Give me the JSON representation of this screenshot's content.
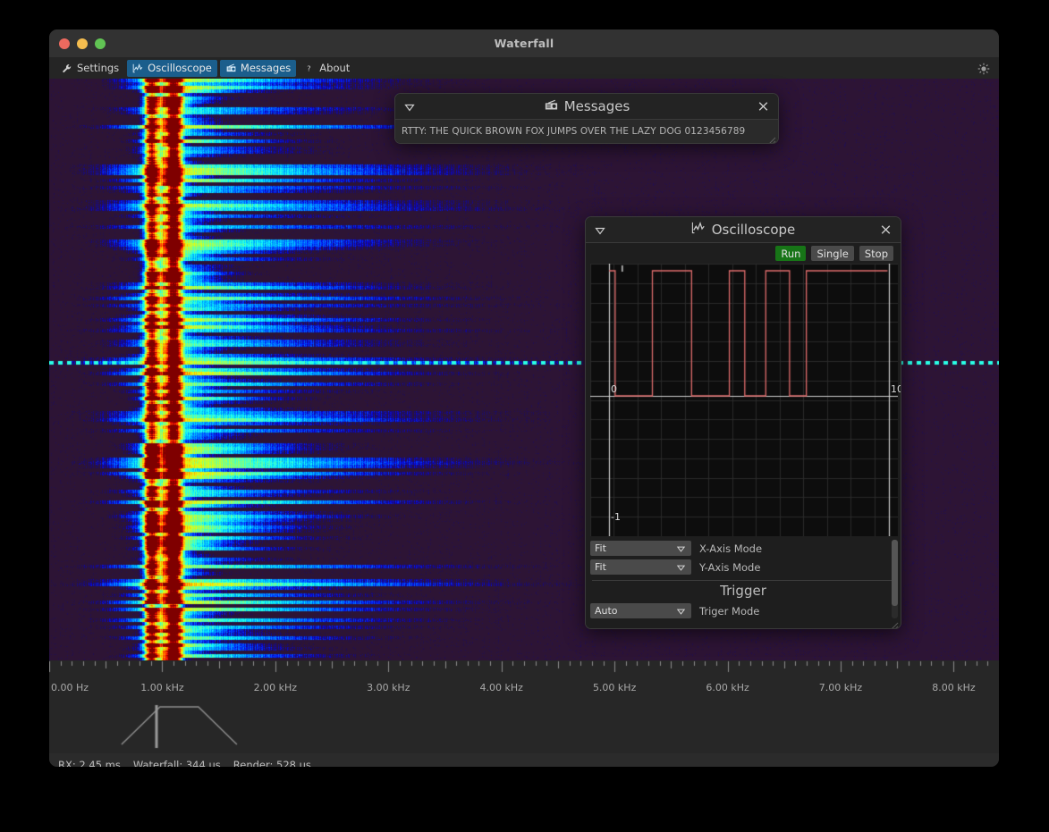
{
  "window": {
    "title": "Waterfall",
    "traffic_lights": [
      "close",
      "minimize",
      "maximize"
    ]
  },
  "toolbar": {
    "tabs": [
      {
        "label": "Settings",
        "icon": "wrench-icon",
        "active": false
      },
      {
        "label": "Oscilloscope",
        "icon": "line-chart-icon",
        "active": true
      },
      {
        "label": "Messages",
        "icon": "radio-icon",
        "active": true
      },
      {
        "label": "About",
        "icon": "question-icon",
        "active": false
      }
    ],
    "brightness_icon": "sun-icon"
  },
  "messages_panel": {
    "title": "Messages",
    "icon": "radio-icon",
    "collapse_icon": "triangle-down-icon",
    "close_icon": "close-icon",
    "message": "RTTY: THE QUICK BROWN FOX JUMPS OVER THE LAZY DOG 0123456789"
  },
  "oscilloscope_panel": {
    "title": "Oscilloscope",
    "icon": "line-chart-icon",
    "collapse_icon": "triangle-down-icon",
    "close_icon": "close-icon",
    "buttons": {
      "run": "Run",
      "single": "Single",
      "stop": "Stop"
    },
    "accent_run_color": "#177517",
    "trace_color": "#e06c6c",
    "axis": {
      "x_min_label": "0",
      "x_max_label": "10",
      "y_min_label": "-1"
    },
    "controls": {
      "x_axis_mode": {
        "value": "Fit",
        "label": "X-Axis Mode"
      },
      "y_axis_mode": {
        "value": "Fit",
        "label": "Y-Axis Mode"
      },
      "trigger_section": "Trigger",
      "trigger_mode": {
        "value": "Auto",
        "label": "Triger Mode"
      }
    }
  },
  "frequency_axis": {
    "labels": [
      "0.00 Hz",
      "1.00 kHz",
      "2.00 kHz",
      "3.00 kHz",
      "4.00 kHz",
      "5.00 kHz",
      "6.00 kHz",
      "7.00 kHz",
      "8.00 kHz"
    ],
    "positions": [
      0,
      1000,
      2000,
      3000,
      4000,
      5000,
      6000,
      7000,
      8000
    ],
    "min": 0,
    "max": 8400,
    "unit": "Hz"
  },
  "status_bar": {
    "rx": "RX: 2.45 ms",
    "waterfall": "Waterfall: 344 us",
    "render": "Render: 528 us"
  },
  "chart_data": {
    "type": "line",
    "title": "Oscilloscope",
    "xlabel": "",
    "ylabel": "",
    "xlim": [
      0,
      10
    ],
    "ylim": [
      -1,
      1
    ],
    "grid": true,
    "series": [
      {
        "name": "trace",
        "color": "#e06c6c",
        "description": "binary square wave, high=1 low=0",
        "x": [
          0,
          0.22,
          0.22,
          1.55,
          1.55,
          2.95,
          2.95,
          4.3,
          4.3,
          4.85,
          4.85,
          5.6,
          5.6,
          6.45,
          6.45,
          7.05,
          7.05,
          9.95
        ],
        "y": [
          1,
          1,
          0,
          0,
          1,
          1,
          0,
          0,
          1,
          1,
          0,
          0,
          1,
          1,
          0,
          0,
          1,
          1
        ]
      }
    ],
    "waterfall": {
      "type": "heatmap",
      "colormap": "jet",
      "x_axis": "frequency",
      "x_range_hz": [
        0,
        8400
      ],
      "signal_center_hz": [
        900,
        1100
      ],
      "description": "RTTY two-tone mark/space carriers with spectral spreading"
    },
    "spectrum": {
      "type": "line",
      "description": "filter bandwidth trapezoid with cursor at ~950 Hz",
      "cursor_hz": 950,
      "band_lo_hz": 980,
      "band_hi_hz": 1320
    }
  }
}
